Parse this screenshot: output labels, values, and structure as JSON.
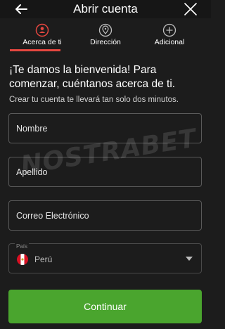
{
  "header": {
    "title": "Abrir cuenta",
    "back_icon": "arrow-left-icon",
    "close_icon": "close-icon"
  },
  "steps": [
    {
      "label": "Acerca de ti",
      "icon": "user-icon",
      "active": true
    },
    {
      "label": "Dirección",
      "icon": "location-pin-icon",
      "active": false
    },
    {
      "label": "Adicional",
      "icon": "plus-circle-icon",
      "active": false
    }
  ],
  "intro": {
    "welcome": "¡Te damos la bienvenida! Para comenzar, cuéntanos acerca de ti.",
    "subtext": "Crear tu cuenta te llevará tan solo dos minutos."
  },
  "form": {
    "nombre_placeholder": "Nombre",
    "apellido_placeholder": "Apellido",
    "correo_placeholder": "Correo Electrónico",
    "country_label": "País",
    "country_value": "Perú"
  },
  "watermark": "NOSTRABET",
  "continue_label": "Continuar",
  "colors": {
    "background": "#1c1c1c",
    "accent_red": "#e64740",
    "button_green": "#4aa52e",
    "field_border": "#5a5a5a"
  }
}
